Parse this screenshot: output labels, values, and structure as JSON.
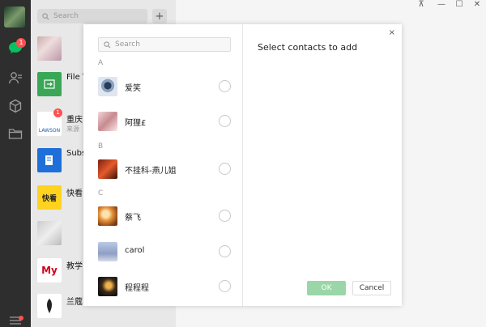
{
  "sidebar": {
    "unread_badge": "1",
    "icons": [
      "chat-icon",
      "contacts-icon",
      "favorites-cube-icon",
      "folder-icon",
      "menu-icon"
    ]
  },
  "chatlist": {
    "search_placeholder": "Search",
    "add_label": "+",
    "items": [
      {
        "name": "",
        "sub": ""
      },
      {
        "name": "File T",
        "sub": ""
      },
      {
        "name": "重庆",
        "sub": "来源",
        "badge": "1"
      },
      {
        "name": "Subs",
        "sub": ""
      },
      {
        "name": "快看",
        "sub": ""
      },
      {
        "name": "",
        "sub": ""
      },
      {
        "name": "教学",
        "sub": ""
      },
      {
        "name": "兰蔻",
        "sub": ""
      }
    ]
  },
  "window": {
    "pin": "⊼",
    "minimize": "—",
    "maximize": "☐",
    "close": "✕"
  },
  "dialog": {
    "search_placeholder": "Search",
    "title": "Select contacts to add",
    "close_label": "×",
    "ok_label": "OK",
    "cancel_label": "Cancel",
    "sections": [
      {
        "letter": "A",
        "contacts": [
          {
            "name": "爱笑"
          },
          {
            "name": "阿狸£"
          }
        ]
      },
      {
        "letter": "B",
        "contacts": [
          {
            "name": "不挂科-燕儿姐"
          }
        ]
      },
      {
        "letter": "C",
        "contacts": [
          {
            "name": "蔡飞"
          },
          {
            "name": "carol"
          },
          {
            "name": "程程程"
          }
        ]
      }
    ]
  },
  "colors": {
    "accent_green": "#07c160",
    "ok_disabled": "#9bd6a8",
    "badge_red": "#fa5151"
  }
}
